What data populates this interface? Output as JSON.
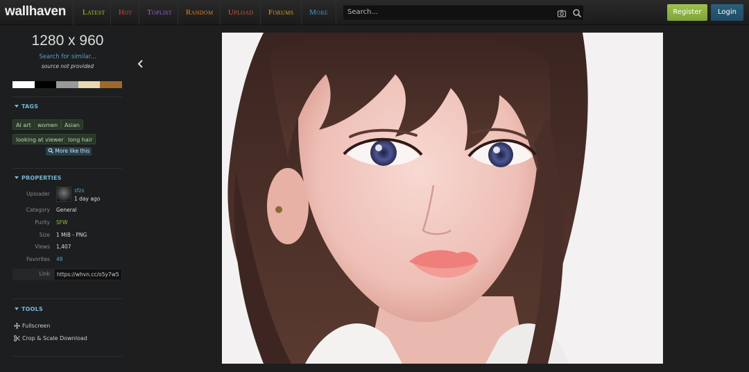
{
  "header": {
    "logo": "wallhaven",
    "nav": [
      {
        "label": "Latest",
        "color": "#b4c42e"
      },
      {
        "label": "Hot",
        "color": "#c84b45"
      },
      {
        "label": "Toplist",
        "color": "#9c5fd1"
      },
      {
        "label": "Random",
        "color": "#e0812a"
      },
      {
        "label": "Upload",
        "color": "#d65a36"
      },
      {
        "label": "Forums",
        "color": "#d9a12b"
      },
      {
        "label": "More",
        "color": "#4b94c9"
      }
    ],
    "search_placeholder": "Search...",
    "register_label": "Register",
    "login_label": "Login"
  },
  "sidebar": {
    "resolution": "1280 x 960",
    "search_similar": "Search for similar...",
    "source": "source not provided",
    "palette": [
      "#ffffff",
      "#000000",
      "#999999",
      "#e7d8b1",
      "#a0682a"
    ],
    "tags_heading": "TAGS",
    "tags": [
      "AI art",
      "women",
      "Asian",
      "looking at viewer",
      "long hair"
    ],
    "more_like_this": "More like this",
    "properties_heading": "PROPERTIES",
    "uploader_label": "Uploader",
    "uploader_name": "sfzs",
    "uploaded_ago": "1 day ago",
    "category_label": "Category",
    "category": "General",
    "purity_label": "Purity",
    "purity": "SFW",
    "size_label": "Size",
    "size": "1 MiB - PNG",
    "views_label": "Views",
    "views": "1,407",
    "favorites_label": "Favorites",
    "favorites": "48",
    "link_label": "Link",
    "link": "https://whvn.cc/o5y7w5",
    "tools_heading": "TOOLS",
    "tool_fullscreen": "Fullscreen",
    "tool_crop": "Crop & Scale Download"
  },
  "colors": {
    "accent_blue": "#76b7d8",
    "purity_sfw": "#8fc14e",
    "favorites": "#4fa9c7"
  }
}
